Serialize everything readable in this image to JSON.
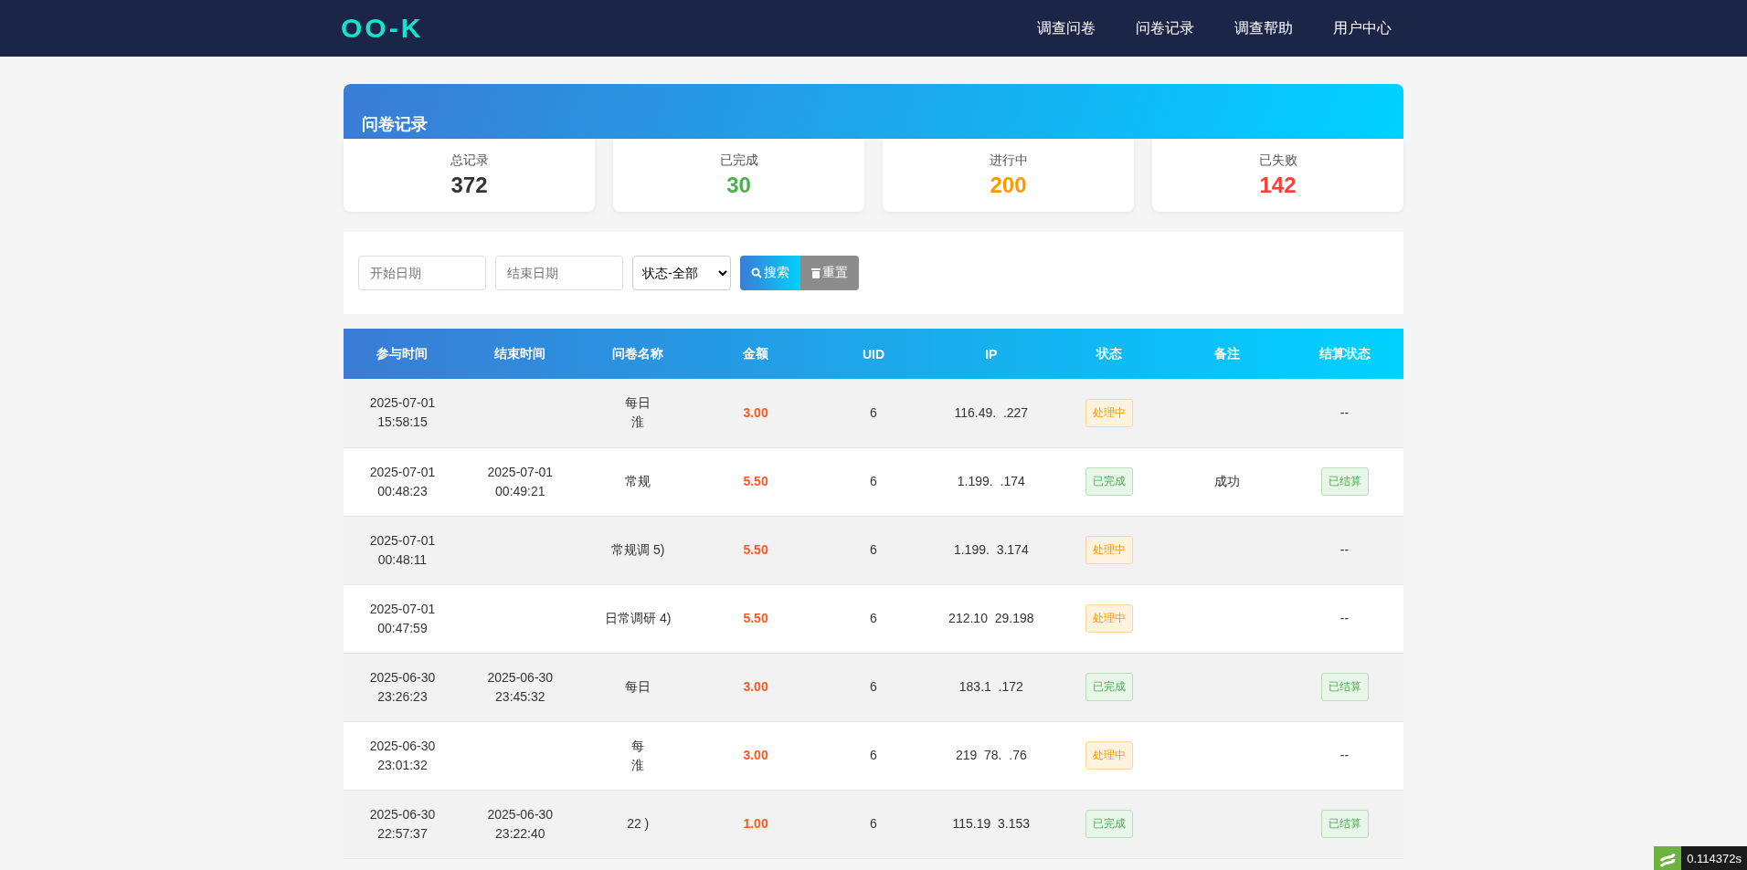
{
  "nav": {
    "logo": "OO-K",
    "links": [
      "调查问卷",
      "问卷记录",
      "调查帮助",
      "用户中心"
    ]
  },
  "panel": {
    "title": "问卷记录"
  },
  "stats": [
    {
      "label": "总记录",
      "value": "372",
      "color": "#333333"
    },
    {
      "label": "已完成",
      "value": "30",
      "color": "#4caf50"
    },
    {
      "label": "进行中",
      "value": "200",
      "color": "#ff9800"
    },
    {
      "label": "已失败",
      "value": "142",
      "color": "#f44336"
    }
  ],
  "filters": {
    "start": {
      "placeholder": "开始日期"
    },
    "end": {
      "placeholder": "结束日期"
    },
    "status": {
      "value": "状态-全部"
    },
    "search": "搜索",
    "reset": "重置"
  },
  "table": {
    "columns": [
      "参与时间",
      "结束时间",
      "问卷名称",
      "金额",
      "UID",
      "IP",
      "状态",
      "备注",
      "结算状态"
    ],
    "rows": [
      {
        "start": [
          "2025-07-01",
          "15:58:15"
        ],
        "end": [],
        "name": [
          "每日",
          "淮"
        ],
        "amount": "3.00",
        "uid": "6",
        "ip": "116.49.  .227",
        "status": {
          "label": "处理中",
          "kind": "pending"
        },
        "note": "",
        "settle": {
          "label": "--",
          "kind": "plain"
        }
      },
      {
        "start": [
          "2025-07-01",
          "00:48:23"
        ],
        "end": [
          "2025-07-01",
          "00:49:21"
        ],
        "name": [
          "常规"
        ],
        "amount": "5.50",
        "uid": "6",
        "ip": "1.199.  .174",
        "status": {
          "label": "已完成",
          "kind": "done"
        },
        "note": "成功",
        "settle": {
          "label": "已结算",
          "kind": "tag"
        }
      },
      {
        "start": [
          "2025-07-01",
          "00:48:11"
        ],
        "end": [],
        "name": [
          "常规调  5)"
        ],
        "amount": "5.50",
        "uid": "6",
        "ip": "1.199.  3.174",
        "status": {
          "label": "处理中",
          "kind": "pending"
        },
        "note": "",
        "settle": {
          "label": "--",
          "kind": "plain"
        }
      },
      {
        "start": [
          "2025-07-01",
          "00:47:59"
        ],
        "end": [],
        "name": [
          "日常调研  4)"
        ],
        "amount": "5.50",
        "uid": "6",
        "ip": "212.10  29.198",
        "status": {
          "label": "处理中",
          "kind": "pending"
        },
        "note": "",
        "settle": {
          "label": "--",
          "kind": "plain"
        }
      },
      {
        "start": [
          "2025-06-30",
          "23:26:23"
        ],
        "end": [
          "2025-06-30",
          "23:45:32"
        ],
        "name": [
          "每日"
        ],
        "amount": "3.00",
        "uid": "6",
        "ip": "183.1  .172",
        "status": {
          "label": "已完成",
          "kind": "done"
        },
        "note": "",
        "settle": {
          "label": "已结算",
          "kind": "tag"
        }
      },
      {
        "start": [
          "2025-06-30",
          "23:01:32"
        ],
        "end": [],
        "name": [
          "每",
          "淮"
        ],
        "amount": "3.00",
        "uid": "6",
        "ip": "219  78.  .76",
        "status": {
          "label": "处理中",
          "kind": "pending"
        },
        "note": "",
        "settle": {
          "label": "--",
          "kind": "plain"
        }
      },
      {
        "start": [
          "2025-06-30",
          "22:57:37"
        ],
        "end": [
          "2025-06-30",
          "23:22:40"
        ],
        "name": [
          "22  )"
        ],
        "amount": "1.00",
        "uid": "6",
        "ip": "115.19  3.153",
        "status": {
          "label": "已完成",
          "kind": "done"
        },
        "note": "",
        "settle": {
          "label": "已结算",
          "kind": "tag"
        }
      }
    ]
  },
  "timer": "0.114372s"
}
